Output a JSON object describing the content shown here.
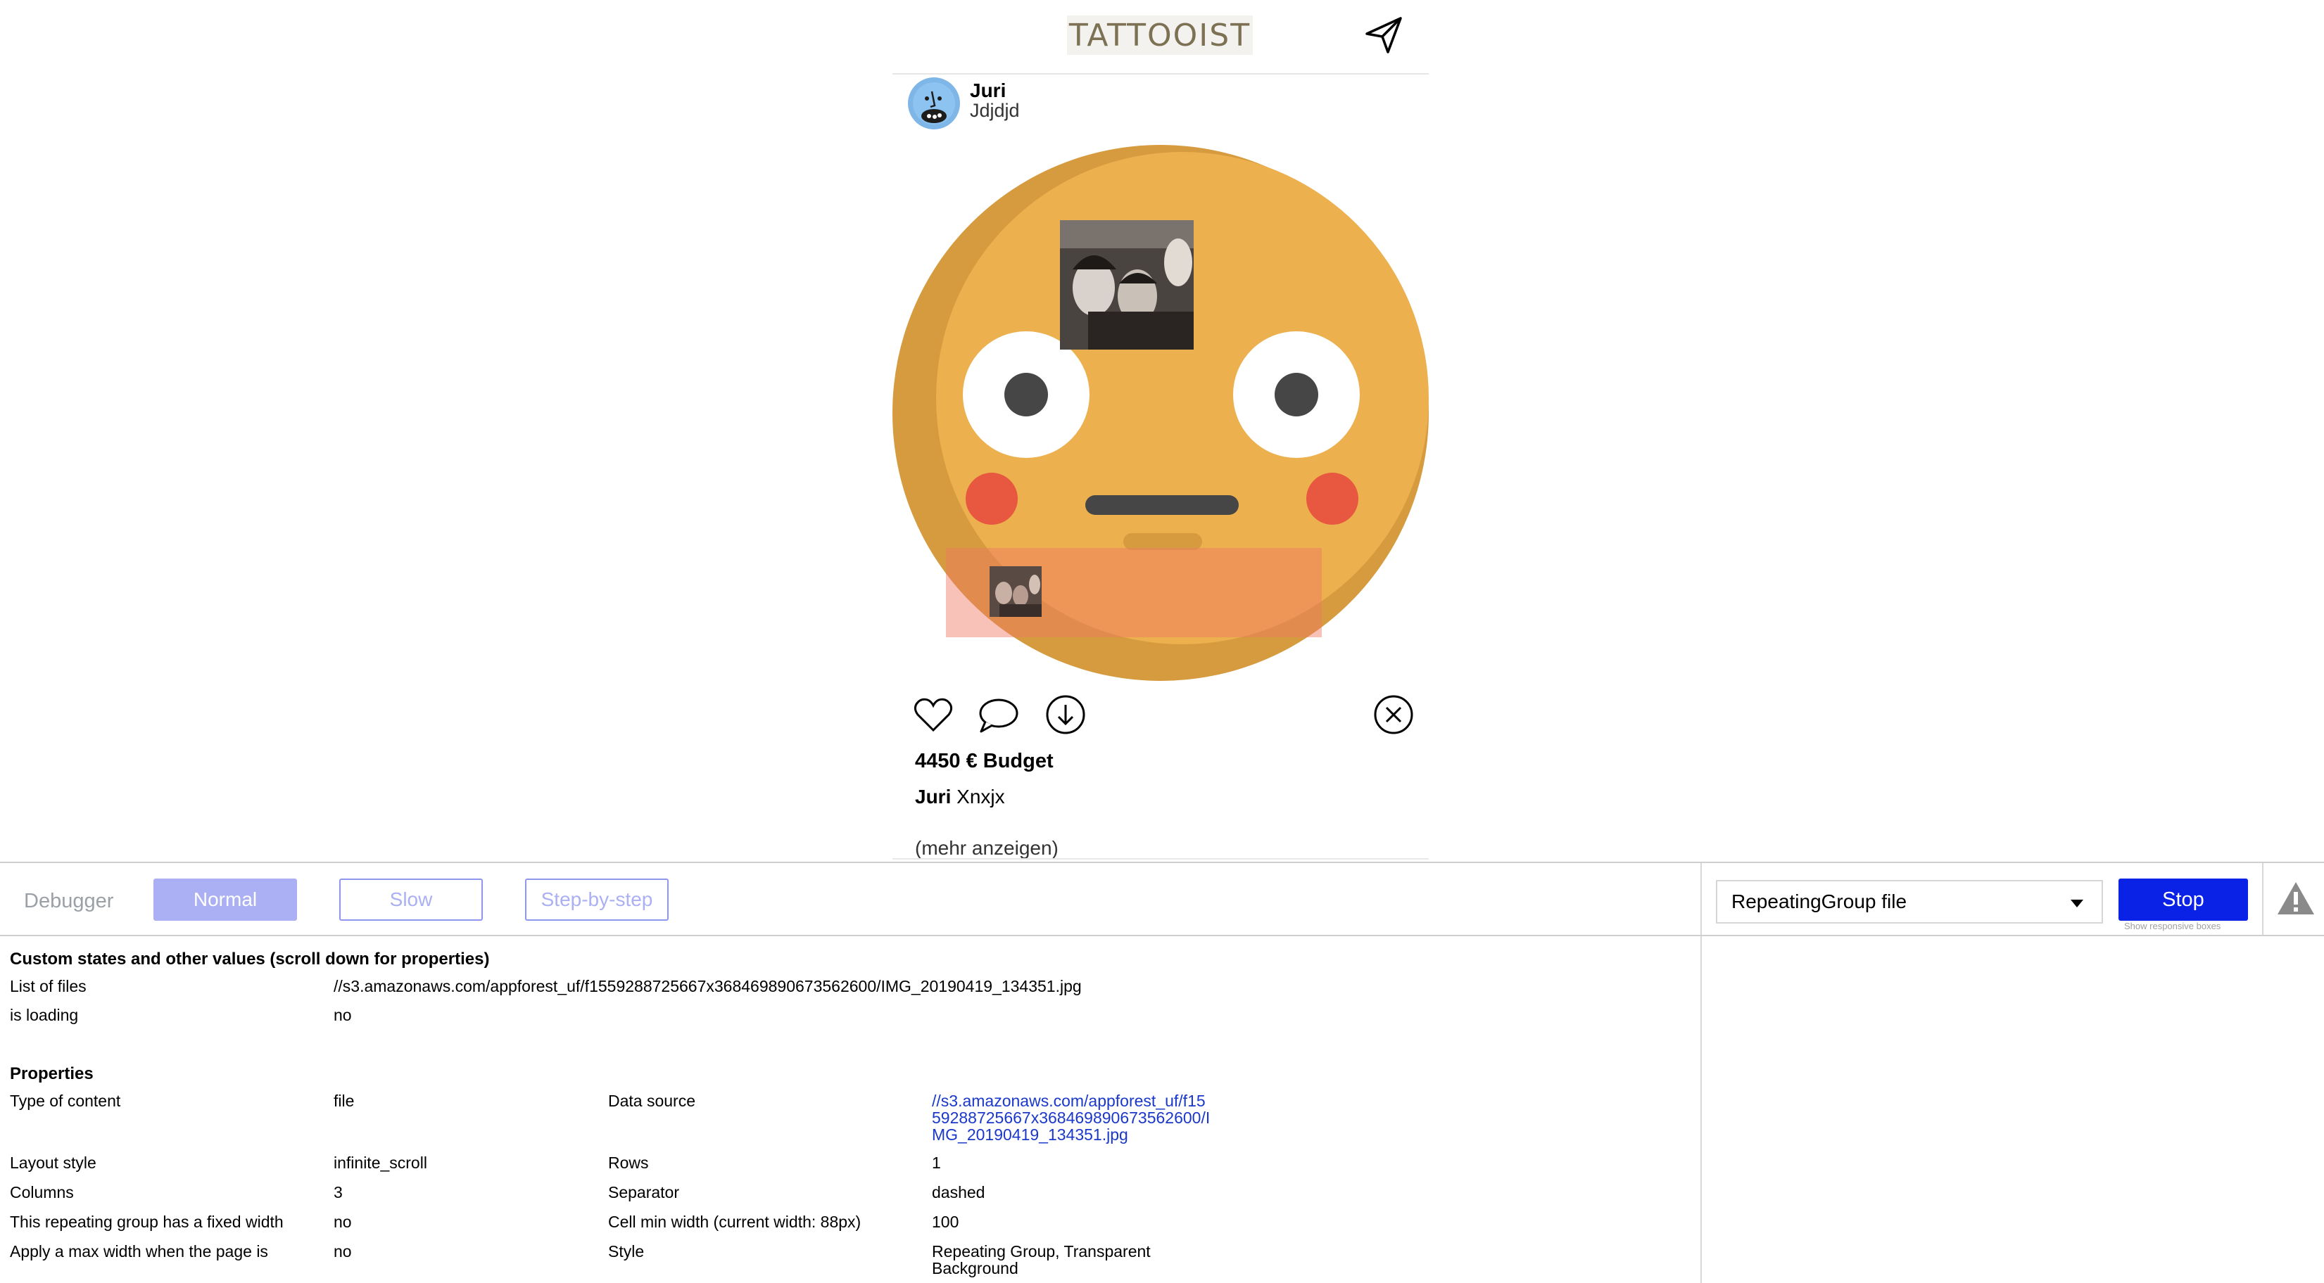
{
  "header": {
    "logo_text": "TATTOOIST",
    "send_icon": "paper-plane-icon"
  },
  "post": {
    "author_name": "Juri",
    "author_subtitle": "Jdjdjd",
    "budget": "4450 € Budget",
    "caption_author": "Juri",
    "caption_text": "Xnxjx",
    "more_link": "(mehr anzeigen)",
    "actions": {
      "like_icon": "heart-icon",
      "comment_icon": "speech-bubble-icon",
      "download_icon": "download-circle-icon",
      "delete_icon": "close-circle-icon"
    },
    "colors": {
      "emoji_face": "#ecb04e",
      "emoji_shadow": "#d69b3f",
      "cheeks": "#e8573f"
    }
  },
  "debugger": {
    "title": "Debugger",
    "modes": [
      "Normal",
      "Slow",
      "Step-by-step"
    ],
    "selected_mode": "Normal",
    "element_selected": "RepeatingGroup file",
    "stop_label": "Stop",
    "responsive_link": "Show responsive boxes",
    "warning_icon": "warning-triangle-icon",
    "accent_color": "#0a21e6",
    "custom_states": {
      "heading": "Custom states and other values (scroll down for properties)",
      "rows": [
        {
          "label": "List of files",
          "value": "//s3.amazonaws.com/appforest_uf/f1559288725667x368469890673562600/IMG_20190419_134351.jpg"
        },
        {
          "label": "is loading",
          "value": "no"
        }
      ]
    },
    "properties": {
      "heading": "Properties",
      "left": [
        {
          "label": "Type of content",
          "value": "file"
        },
        {
          "label": "Layout style",
          "value": "infinite_scroll"
        },
        {
          "label": "Columns",
          "value": "3"
        },
        {
          "label": "This repeating group has a fixed width",
          "value": "no"
        },
        {
          "label": "Apply a max width when the page is",
          "value": "no"
        }
      ],
      "right": [
        {
          "label": "Data source",
          "value": "//s3.amazonaws.com/appforest_uf/f1559288725667x368469890673562600/IMG_20190419_134351.jpg"
        },
        {
          "label": "Rows",
          "value": "1"
        },
        {
          "label": "Separator",
          "value": "dashed"
        },
        {
          "label": "Cell min width (current width: 88px)",
          "value": "100"
        },
        {
          "label": "Style",
          "value": "Repeating Group, Transparent Background"
        }
      ]
    }
  }
}
